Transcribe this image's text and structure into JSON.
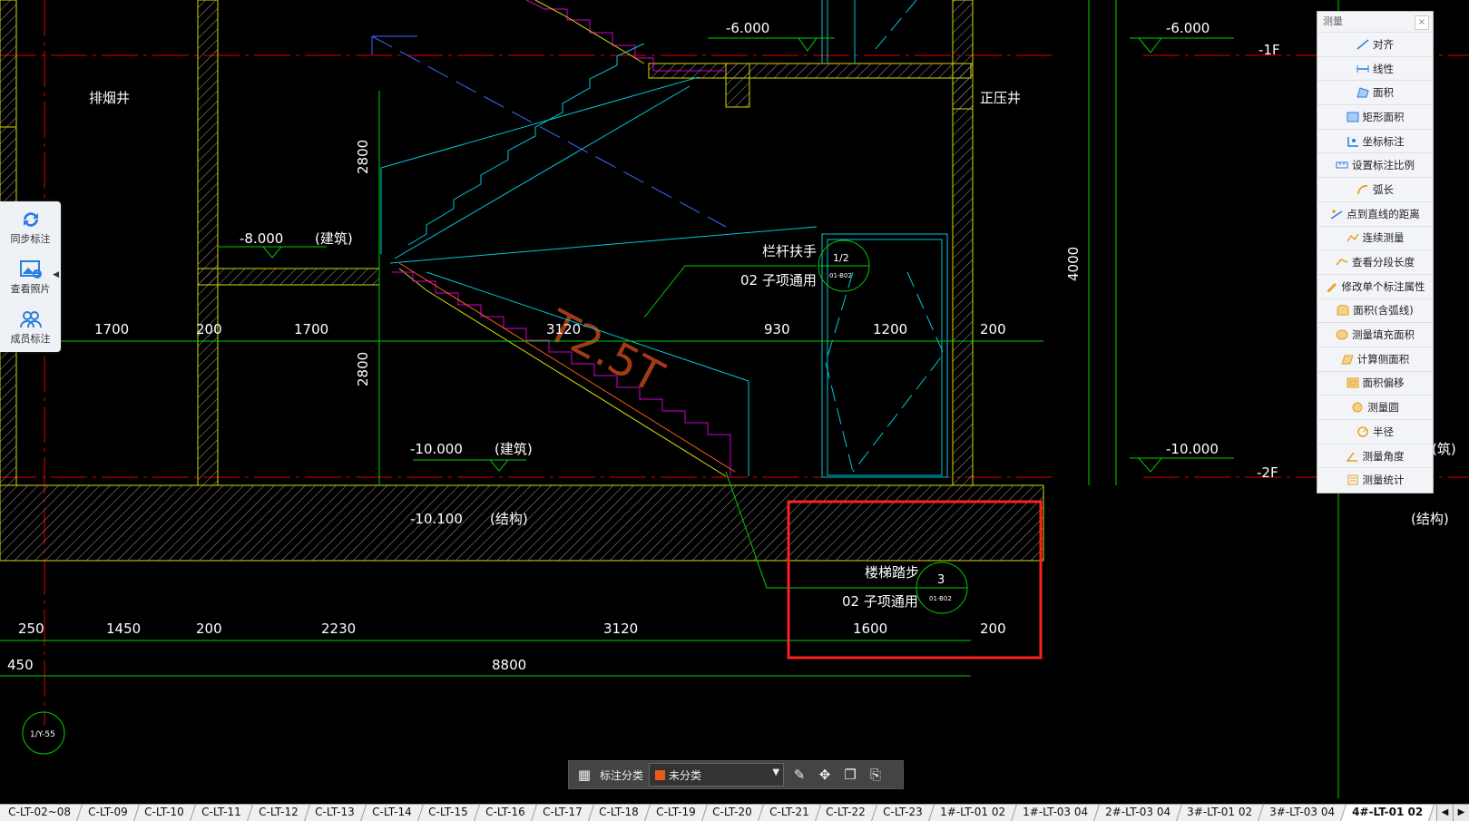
{
  "drawing": {
    "levels_top": [
      "-6.000",
      "-6.000",
      "-1F"
    ],
    "levels_mid": [
      "-8.000",
      "(建筑)"
    ],
    "levels_bottom": [
      "-10.000",
      "(建筑)",
      "-10.000",
      "(筑)",
      "-2F"
    ],
    "structural_level": [
      "-10.100",
      "(结构)",
      "(结构)"
    ],
    "room_labels": [
      "排烟井",
      "正压井"
    ],
    "callout_rail": {
      "line1": "栏杆扶手",
      "line2": "02 子项通用",
      "ref_top": "1/2",
      "ref_bottom": "01-B02"
    },
    "callout_tread": {
      "line1": "楼梯踏步",
      "line2": "02 子项通用",
      "ref_top": "3",
      "ref_bottom": "01-B02"
    },
    "slope_label": "T2.5T",
    "vertical_dims": [
      "2800",
      "2800",
      "4000"
    ],
    "dims_middle": [
      "1700",
      "200",
      "1700",
      "3120",
      "930",
      "1200",
      "200"
    ],
    "dims_bottom": [
      "250",
      "1450",
      "200",
      "2230",
      "3120",
      "1600",
      "200"
    ],
    "dims_total": [
      "450",
      "8800"
    ],
    "grid_bubble": "1/Y-55"
  },
  "left_panel": {
    "items": [
      {
        "label": "同步标注",
        "icon": "sync-icon"
      },
      {
        "label": "查看照片",
        "icon": "photo-icon"
      },
      {
        "label": "成员标注",
        "icon": "members-icon"
      }
    ]
  },
  "measure_panel": {
    "title": "测量",
    "close": "×",
    "items": [
      {
        "label": "对齐",
        "icon": "align-measure-icon"
      },
      {
        "label": "线性",
        "icon": "linear-measure-icon"
      },
      {
        "label": "面积",
        "icon": "area-icon"
      },
      {
        "label": "矩形面积",
        "icon": "rect-area-icon"
      },
      {
        "label": "坐标标注",
        "icon": "coordinate-icon"
      },
      {
        "label": "设置标注比例",
        "icon": "scale-icon"
      },
      {
        "label": "弧长",
        "icon": "arc-icon"
      },
      {
        "label": "点到直线的距离",
        "icon": "point-line-icon"
      },
      {
        "label": "连续测量",
        "icon": "continuous-icon"
      },
      {
        "label": "查看分段长度",
        "icon": "segment-icon"
      },
      {
        "label": "修改单个标注属性",
        "icon": "edit-annotation-icon"
      },
      {
        "label": "面积(含弧线)",
        "icon": "arc-area-icon"
      },
      {
        "label": "测量填充面积",
        "icon": "fill-area-icon"
      },
      {
        "label": "计算侧面积",
        "icon": "side-area-icon"
      },
      {
        "label": "面积偏移",
        "icon": "area-offset-icon"
      },
      {
        "label": "测量圆",
        "icon": "circle-icon"
      },
      {
        "label": "半径",
        "icon": "radius-icon"
      },
      {
        "label": "测量角度",
        "icon": "angle-icon"
      },
      {
        "label": "测量统计",
        "icon": "statistics-icon"
      }
    ]
  },
  "bottom_toolbar": {
    "label": "标注分类",
    "selected": "未分类",
    "swatch_color": "#e85b1d"
  },
  "tabs": [
    "C-LT-02~08",
    "C-LT-09",
    "C-LT-10",
    "C-LT-11",
    "C-LT-12",
    "C-LT-13",
    "C-LT-14",
    "C-LT-15",
    "C-LT-16",
    "C-LT-17",
    "C-LT-18",
    "C-LT-19",
    "C-LT-20",
    "C-LT-21",
    "C-LT-22",
    "C-LT-23",
    "1#-LT-01 02",
    "1#-LT-03 04",
    "2#-LT-03 04",
    "3#-LT-01 02",
    "3#-LT-03 04",
    "4#-LT-01 02"
  ],
  "active_tab": "4#-LT-01 02",
  "colors": {
    "wall": "#d8d800",
    "dim": "#00d000",
    "axis": "#e00000",
    "stair": "#00c8d8",
    "edge": "#d000d0",
    "text": "#ffffff",
    "highlight": "#ff2020"
  }
}
